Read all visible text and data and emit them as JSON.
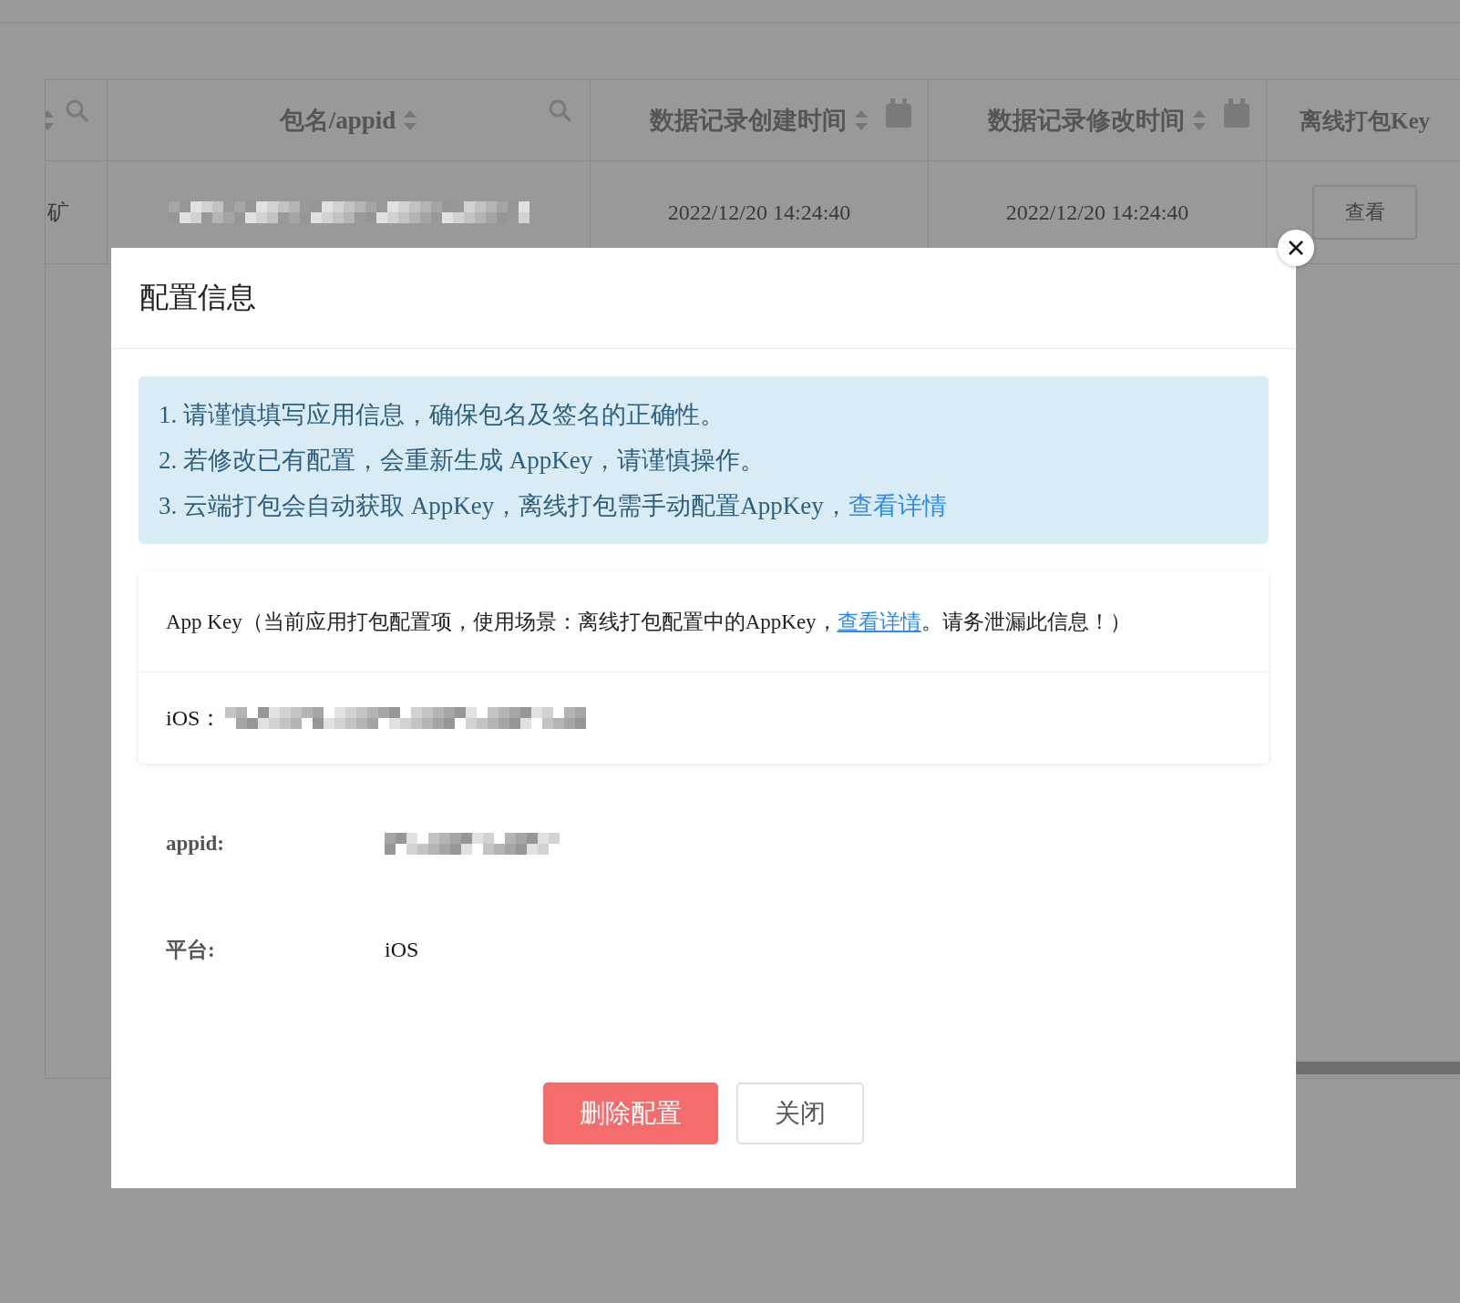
{
  "table": {
    "columns": [
      {
        "sortable": true,
        "filter": {
          "kind": "search"
        }
      },
      {
        "label": "包名/appid",
        "sortable": true,
        "filter": {
          "kind": "search"
        }
      },
      {
        "label": "数据记录创建时间",
        "sortable": true,
        "filter": {
          "kind": "date"
        }
      },
      {
        "label": "数据记录修改时间",
        "sortable": true,
        "filter": {
          "kind": "date"
        }
      },
      {
        "label": "离线打包Key",
        "sortable": false
      }
    ],
    "rows": [
      {
        "cells": [
          {
            "kind": "text",
            "text": "矿"
          },
          {
            "kind": "masked"
          },
          {
            "kind": "text",
            "text": "2022/12/20 14:24:40"
          },
          {
            "kind": "text",
            "text": "2022/12/20 14:24:40"
          },
          {
            "kind": "button",
            "text": "查看"
          }
        ]
      }
    ]
  },
  "dialog": {
    "title": "配置信息",
    "notices": [
      {
        "text": "1. 请谨慎填写应用信息，确保包名及签名的正确性。"
      },
      {
        "text": "2. 若修改已有配置，会重新生成 AppKey，请谨慎操作。"
      },
      {
        "text": "3. 云端打包会自动获取 AppKey，离线打包需手动配置AppKey，",
        "link": "查看详情"
      }
    ],
    "appkey_card": {
      "before": "App Key（当前应用打包配置项，使用场景：离线打包配置中的AppKey，",
      "link": "查看详情",
      "after": "。请务泄漏此信息！）",
      "rows": [
        {
          "label": "iOS：",
          "masked": true
        }
      ]
    },
    "fields": [
      {
        "label": "appid:",
        "masked": true
      },
      {
        "label": "平台:",
        "value": "iOS"
      }
    ],
    "buttons": [
      {
        "label": "删除配置",
        "kind": "danger"
      },
      {
        "label": "关闭",
        "kind": "default"
      }
    ]
  }
}
